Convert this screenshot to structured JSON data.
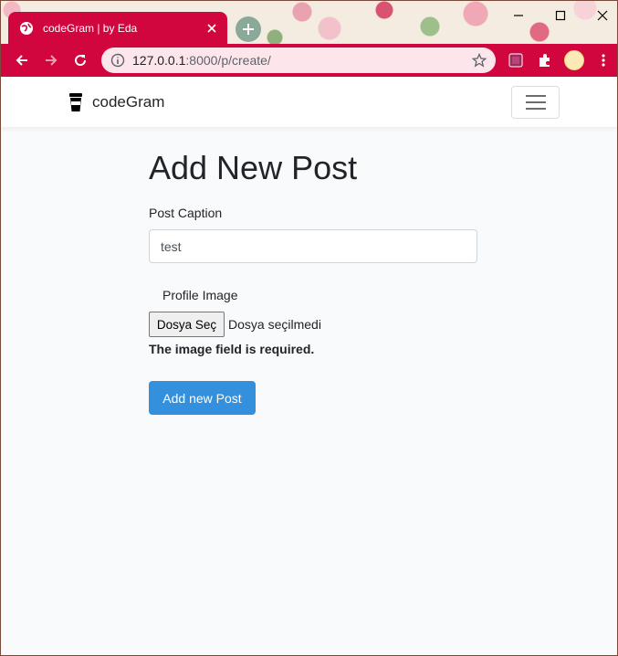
{
  "browser": {
    "tab_title": "codeGram | by Eda",
    "url_host": "127.0.0.1",
    "url_rest": ":8000/p/create/"
  },
  "navbar": {
    "brand": "codeGram"
  },
  "form": {
    "heading": "Add New Post",
    "caption_label": "Post Caption",
    "caption_value": "test",
    "image_label": "Profile Image",
    "file_button": "Dosya Seç",
    "file_status": "Dosya seçilmedi",
    "error": "The image field is required.",
    "submit": "Add new Post"
  },
  "colors": {
    "chrome_accent": "#d1063f",
    "primary_button": "#3490dc",
    "page_bg": "#f8fafc"
  }
}
